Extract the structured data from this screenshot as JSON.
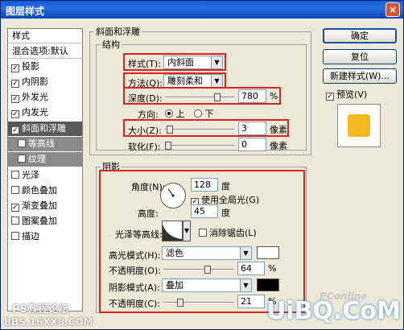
{
  "window": {
    "title": "图层样式",
    "close": "×"
  },
  "sidebar": {
    "header": "样式",
    "blend": "混合选项:默认",
    "items": [
      {
        "label": "投影",
        "checked": true
      },
      {
        "label": "内阴影",
        "checked": true
      },
      {
        "label": "外发光",
        "checked": true
      },
      {
        "label": "内发光",
        "checked": true
      },
      {
        "label": "斜面和浮雕",
        "checked": true
      },
      {
        "label": "等高线",
        "checked": false
      },
      {
        "label": "纹理",
        "checked": false
      },
      {
        "label": "光泽",
        "checked": false
      },
      {
        "label": "颜色叠加",
        "checked": false
      },
      {
        "label": "渐变叠加",
        "checked": true
      },
      {
        "label": "图案叠加",
        "checked": false
      },
      {
        "label": "描边",
        "checked": false
      }
    ]
  },
  "bevel": {
    "group_title": "斜面和浮雕",
    "structure_title": "结构",
    "style_label": "样式(T):",
    "style_value": "内斜面",
    "technique_label": "方法(Q):",
    "technique_value": "雕刻柔和",
    "depth_label": "深度(D):",
    "depth_value": "780",
    "depth_unit": "%",
    "depth_level": 0.78,
    "direction_label": "方向:",
    "dir_up": "上",
    "dir_down": "下",
    "size_label": "大小(Z):",
    "size_value": "3",
    "size_unit": "像素",
    "size_level": 0.02,
    "soften_label": "软化(F):",
    "soften_value": "0",
    "soften_unit": "像素",
    "soften_level": 0.0
  },
  "shading": {
    "title": "阴影",
    "angle_label": "角度(N):",
    "angle_value": "128",
    "angle_unit": "度",
    "global_light": "使用全局光(G)",
    "altitude_label": "高度:",
    "altitude_value": "45",
    "altitude_unit": "度",
    "gloss_label": "光泽等高线:",
    "antialias": "消除锯齿(L)",
    "highlight_mode_label": "高光模式(H):",
    "highlight_mode_value": "滤色",
    "opacity1_label": "不透明度(O):",
    "opacity1_value": "64",
    "opacity1_unit": "%",
    "opacity1_level": 0.64,
    "shadow_mode_label": "阴影模式(A):",
    "shadow_mode_value": "叠加",
    "opacity2_label": "不透明度(C):",
    "opacity2_value": "21",
    "opacity2_unit": "%",
    "opacity2_level": 0.21
  },
  "buttons": {
    "ok": "确定",
    "reset": "复位",
    "new_style": "新建样式(W)...",
    "preview": "预览(V)"
  },
  "colors": {
    "highlight": "#ffffff",
    "shadow": "#000000",
    "preview_fill": "#f4b820",
    "red": "#e0201c"
  },
  "watermarks": {
    "left": "PS教程论坛",
    "bottom": "BBS.16XX8.COM",
    "brand": "UiBQ.CoM",
    "pconline": "PConline"
  }
}
